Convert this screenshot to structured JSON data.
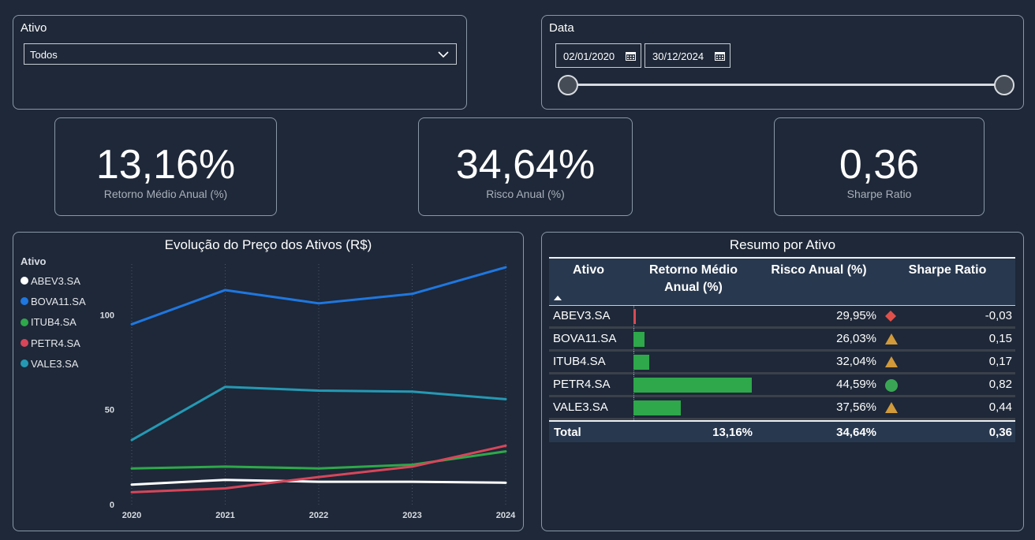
{
  "ativo_slicer": {
    "title": "Ativo",
    "selected": "Todos"
  },
  "data_slicer": {
    "title": "Data",
    "start": "02/01/2020",
    "end": "30/12/2024"
  },
  "kpis": [
    {
      "value": "13,16%",
      "label": "Retorno Médio Anual (%)"
    },
    {
      "value": "34,64%",
      "label": "Risco Anual (%)"
    },
    {
      "value": "0,36",
      "label": "Sharpe Ratio"
    }
  ],
  "line_chart": {
    "title": "Evolução do Preço dos Ativos (R$)",
    "legend_title": "Ativo",
    "legend": [
      {
        "name": "ABEV3.SA",
        "color": "#ffffff"
      },
      {
        "name": "BOVA11.SA",
        "color": "#1f77e0"
      },
      {
        "name": "ITUB4.SA",
        "color": "#2ea84a"
      },
      {
        "name": "PETR4.SA",
        "color": "#d8465a"
      },
      {
        "name": "VALE3.SA",
        "color": "#2599b4"
      }
    ]
  },
  "chart_data": {
    "type": "line",
    "title": "Evolução do Preço dos Ativos (R$)",
    "xlabel": "",
    "ylabel": "",
    "x": [
      "2020",
      "2021",
      "2022",
      "2023",
      "2024"
    ],
    "yticks": [
      0,
      50,
      100
    ],
    "ylim": [
      0,
      135
    ],
    "grid": "vertical dotted",
    "legend_position": "left",
    "series": [
      {
        "name": "ABEV3.SA",
        "color": "#ffffff",
        "values": [
          10.5,
          13,
          12,
          12,
          11.5
        ]
      },
      {
        "name": "BOVA11.SA",
        "color": "#1f77e0",
        "values": [
          95,
          113,
          106,
          111,
          125
        ]
      },
      {
        "name": "ITUB4.SA",
        "color": "#2ea84a",
        "values": [
          19,
          20,
          19,
          21,
          28
        ]
      },
      {
        "name": "PETR4.SA",
        "color": "#d8465a",
        "values": [
          6.5,
          8.5,
          14.5,
          20,
          31
        ]
      },
      {
        "name": "VALE3.SA",
        "color": "#2599b4",
        "values": [
          34,
          62,
          60,
          59.5,
          55.5
        ]
      }
    ]
  },
  "summary_table": {
    "title": "Resumo por Ativo",
    "headers": {
      "ativo": "Ativo",
      "retorno": "Retorno Médio Anual (%)",
      "risco": "Risco Anual (%)",
      "sharpe": "Sharpe Ratio"
    },
    "rows": [
      {
        "ativo": "ABEV3.SA",
        "retorno": -0.3,
        "risco": "29,95%",
        "sharpe": "-0,03",
        "icon": "red-diamond-icon"
      },
      {
        "ativo": "BOVA11.SA",
        "retorno": 1.4,
        "risco": "26,03%",
        "sharpe": "0,15",
        "icon": "orange-triangle-icon"
      },
      {
        "ativo": "ITUB4.SA",
        "retorno": 2.0,
        "risco": "32,04%",
        "sharpe": "0,17",
        "icon": "orange-triangle-icon"
      },
      {
        "ativo": "PETR4.SA",
        "retorno": 15.0,
        "risco": "44,59%",
        "sharpe": "0,82",
        "icon": "green-circle-icon"
      },
      {
        "ativo": "VALE3.SA",
        "retorno": 6.0,
        "risco": "37,56%",
        "sharpe": "0,44",
        "icon": "orange-triangle-icon"
      }
    ],
    "total": {
      "label": "Total",
      "retorno": "13,16%",
      "risco": "34,64%",
      "sharpe": "0,36"
    },
    "colors": {
      "positive_bar": "#2ea84a",
      "negative_bar": "#d84b55",
      "red": "#e0504b",
      "orange": "#d29a3a",
      "green": "#3aa655"
    }
  }
}
